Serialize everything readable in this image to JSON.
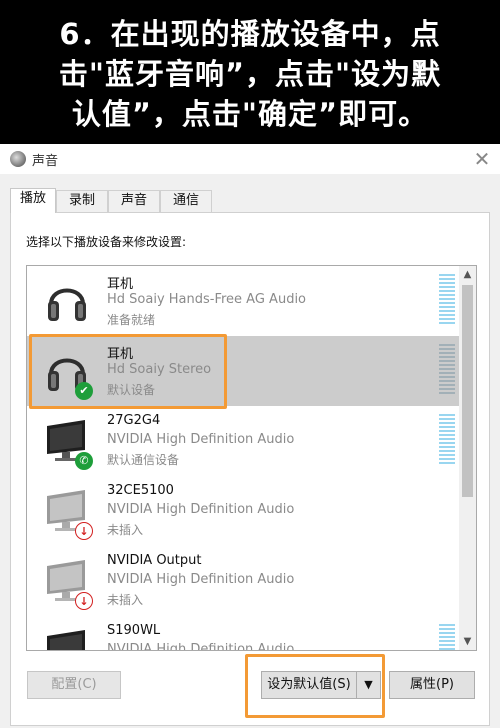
{
  "banner": {
    "line1": "6．在出现的播放设备中，点",
    "line2": "击\"蓝牙音响”，点击\"设为默",
    "line3": "认值”，点击\"确定”即可。"
  },
  "window": {
    "title": "声音",
    "close_glyph": "✕"
  },
  "tabs": [
    {
      "label": "播放"
    },
    {
      "label": "录制"
    },
    {
      "label": "声音"
    },
    {
      "label": "通信"
    }
  ],
  "instruction": "选择以下播放设备来修改设置:",
  "devices": [
    {
      "name": "耳机",
      "description": "Hd Soaiy Hands-Free AG Audio",
      "status": "准备就绪",
      "icon": "headphones-icon"
    },
    {
      "name": "耳机",
      "description": "Hd Soaiy Stereo",
      "status": "默认设备",
      "icon": "headphones-icon",
      "badge": "default-check-icon"
    },
    {
      "name": "27G2G4",
      "description": "NVIDIA High Definition Audio",
      "status": "默认通信设备",
      "icon": "monitor-icon",
      "badge": "phone-icon"
    },
    {
      "name": "32CE5100",
      "description": "NVIDIA High Definition Audio",
      "status": "未插入",
      "icon": "monitor-icon",
      "badge": "unplugged-arrow-icon"
    },
    {
      "name": "NVIDIA Output",
      "description": "NVIDIA High Definition Audio",
      "status": "未插入",
      "icon": "monitor-icon",
      "badge": "unplugged-arrow-icon"
    },
    {
      "name": "S190WL",
      "description": "NVIDIA High Definition Audio",
      "status": "",
      "icon": "monitor-icon",
      "badge": ""
    }
  ],
  "buttons": {
    "configure": "配置(C)",
    "set_default": "设为默认值(S)",
    "properties": "属性(P)"
  },
  "colors": {
    "highlight": "#f39a35",
    "check": "#1e9e3a",
    "unplugged": "#d32020",
    "selected_row": "#cccccc"
  }
}
